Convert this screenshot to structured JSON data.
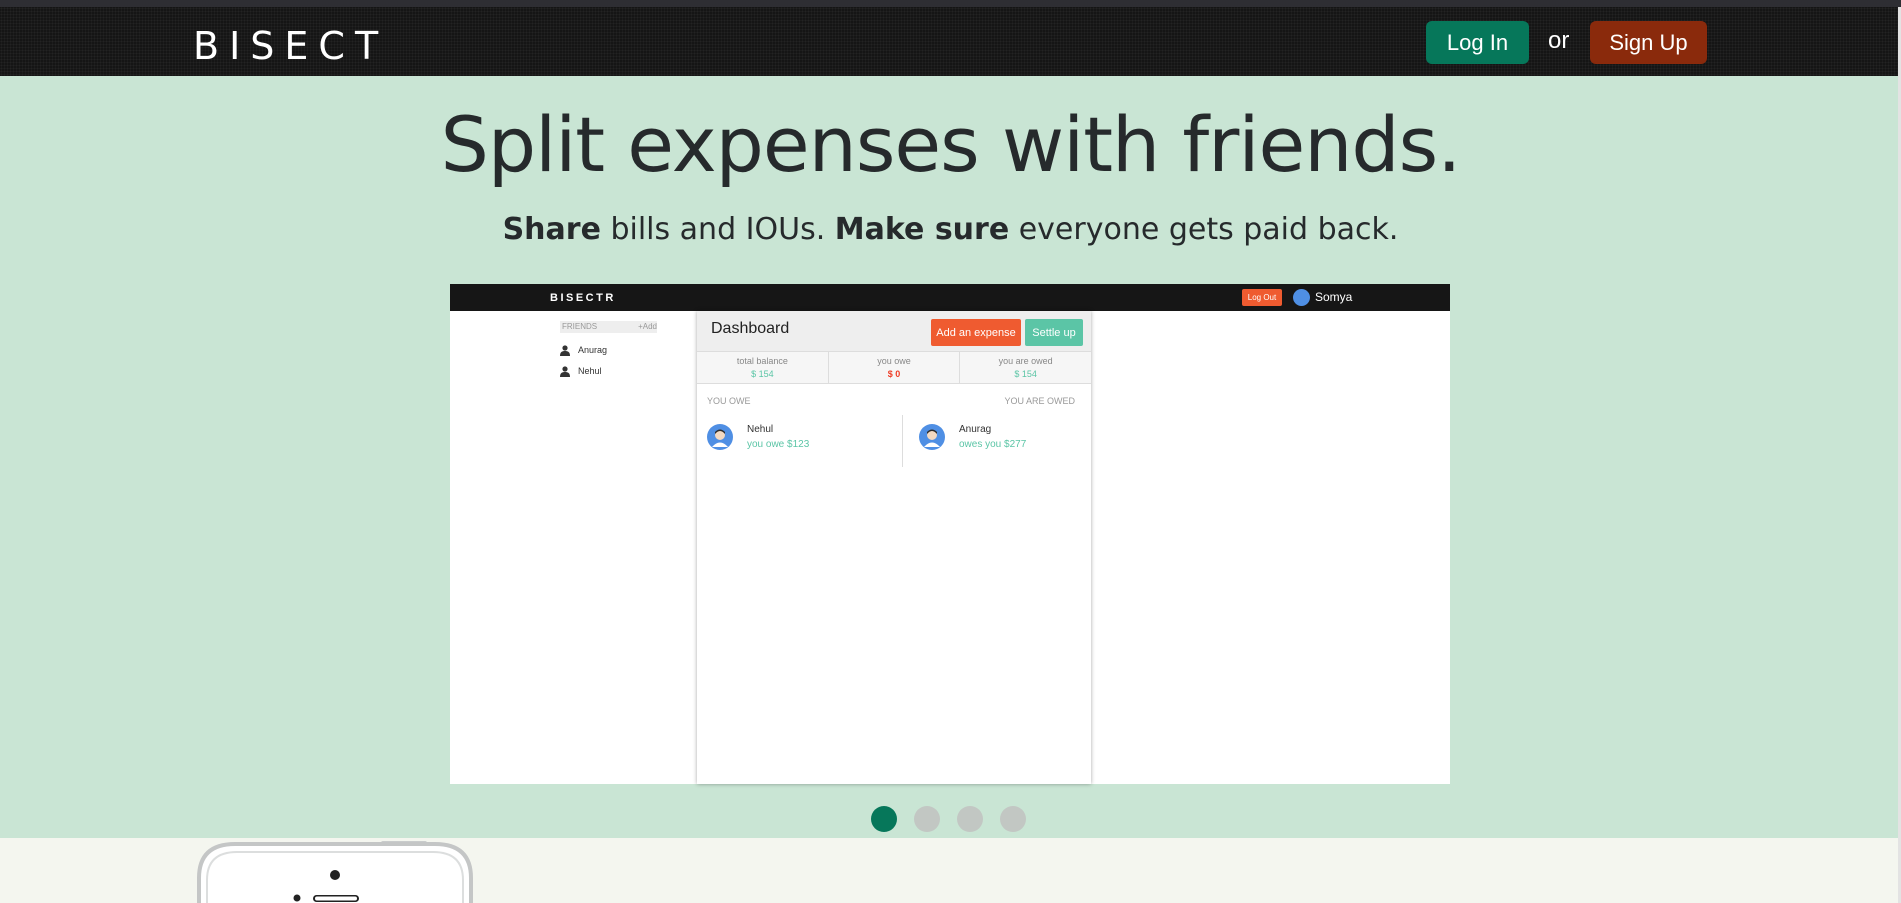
{
  "navbar": {
    "brand": "BISECT",
    "login_label": "Log In",
    "or_label": "or",
    "signup_label": "Sign Up"
  },
  "hero": {
    "headline": "Split expenses with friends.",
    "sub_part1_bold": "Share",
    "sub_part2": " bills and IOUs. ",
    "sub_part3_bold": "Make sure",
    "sub_part4": " everyone gets paid back."
  },
  "screenshot": {
    "brand": "BISECTR",
    "logout_label": "Log Out",
    "user_name": "Somya",
    "friends_label": "FRIENDS",
    "add_label": "+Add",
    "friends": [
      "Anurag",
      "Nehul"
    ],
    "dashboard_title": "Dashboard",
    "add_expense_label": "Add an expense",
    "settle_up_label": "Settle up",
    "stats": [
      {
        "label": "total balance",
        "value": "$ 154"
      },
      {
        "label": "you owe",
        "value": "$ 0"
      },
      {
        "label": "you are owed",
        "value": "$ 154"
      }
    ],
    "you_owe_heading": "YOU OWE",
    "you_are_owed_heading": "YOU ARE OWED",
    "owe_entry": {
      "name": "Nehul",
      "amount_text": "you owe $123"
    },
    "owed_entry": {
      "name": "Anurag",
      "amount_text": "owes you $277"
    }
  },
  "carousel": {
    "slide_count": 4,
    "active_index": 0
  },
  "colors": {
    "hero_bg": "#c9e5d4",
    "login_green": "#06775a",
    "signup_red": "#8a2a0c",
    "accent_orange": "#ef5b30",
    "accent_teal": "#5bc5a6"
  },
  "icons": {
    "person": "person-icon",
    "avatar": "avatar-icon",
    "phone": "phone-mockup"
  }
}
